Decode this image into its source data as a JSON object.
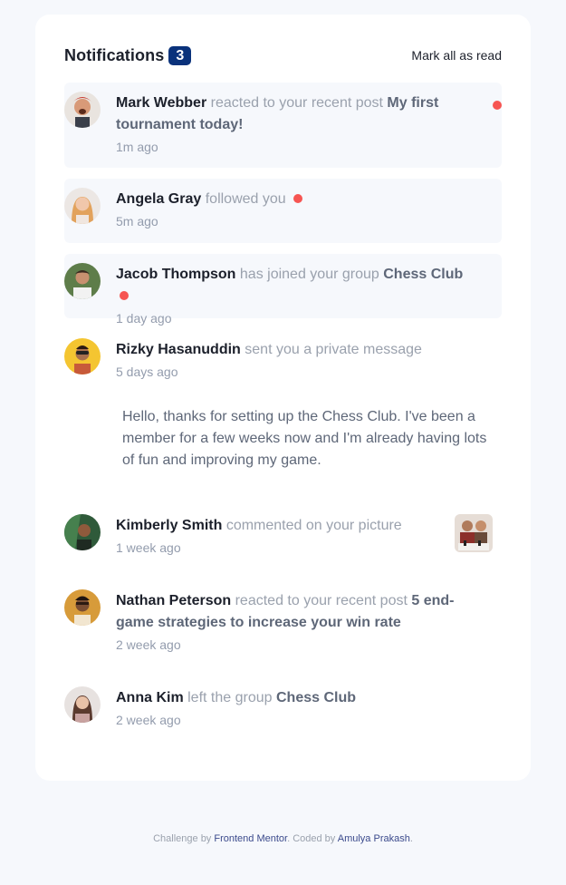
{
  "header": {
    "title": "Notifications",
    "count": "3",
    "mark_all": "Mark all as read"
  },
  "notifications": [
    {
      "actor": "Mark Webber",
      "action": "reacted to your recent post",
      "target": "My first tournament today!",
      "time": "1m ago",
      "unread": true
    },
    {
      "actor": "Angela Gray",
      "action": "followed you",
      "time": "5m ago",
      "unread": true
    },
    {
      "actor": "Jacob Thompson",
      "action": "has joined your group",
      "target": "Chess Club",
      "time": "1 day ago",
      "unread": true
    },
    {
      "actor": "Rizky Hasanuddin",
      "action": "sent you a private message",
      "time": "5 days ago",
      "message": "Hello, thanks for setting up the Chess Club. I've been a member for a few weeks now and I'm already having lots of fun and improving my game.",
      "unread": false
    },
    {
      "actor": "Kimberly Smith",
      "action": "commented on your picture",
      "time": "1 week ago",
      "unread": false
    },
    {
      "actor": "Nathan Peterson",
      "action": "reacted to your recent post",
      "target": "5 end-game strategies to increase your win rate",
      "time": "2 week ago",
      "unread": false
    },
    {
      "actor": "Anna Kim",
      "action": "left the group",
      "target": "Chess Club",
      "time": "2 week ago",
      "unread": false
    }
  ],
  "footer": {
    "prefix": "Challenge by",
    "link1": "Frontend Mentor",
    "middle": ". Coded by",
    "link2": "Amulya Prakash",
    "suffix": "."
  },
  "colors": {
    "unread_dot": "#f65552",
    "badge": "#0a327b",
    "unread_bg": "#f6f8fc"
  }
}
